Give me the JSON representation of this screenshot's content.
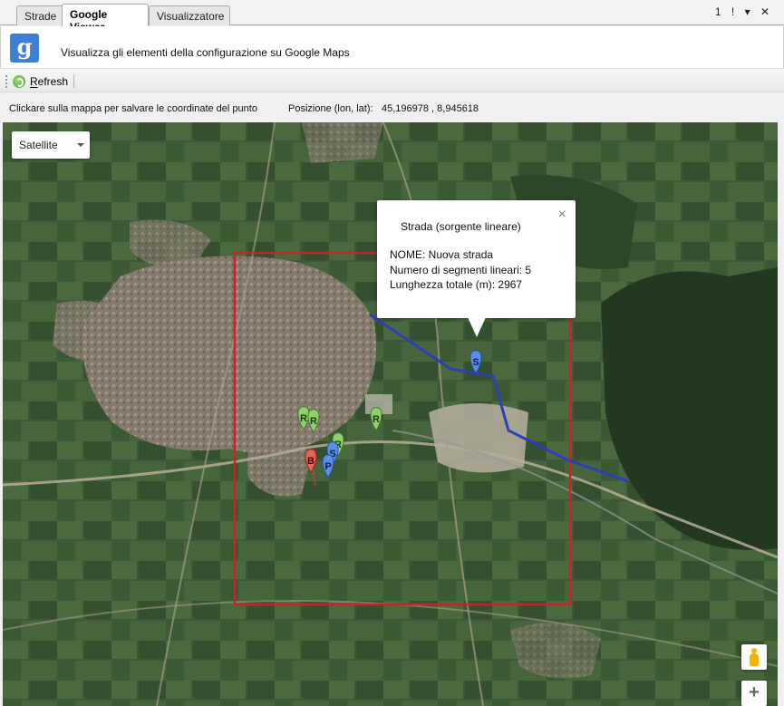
{
  "tabs": [
    {
      "label": "Strade"
    },
    {
      "label": "Google Viewer"
    },
    {
      "label": "Visualizzatore"
    }
  ],
  "tab_controls": "1 ! ▾ ✕",
  "header": {
    "logo_letter": "g",
    "description": "Visualizza gli elementi della configurazione su Google Maps"
  },
  "toolbar": {
    "refresh_first_letter": "R",
    "refresh_rest": "efresh"
  },
  "status": {
    "hint": "Clickare sulla mappa per salvare le coordinate del punto",
    "position_label": "Posizione (lon, lat):",
    "position_value": "45,196978 , 8,945618"
  },
  "map": {
    "type_selected": "Satellite",
    "infowindow": {
      "close": "×",
      "title": "Strada (sorgente lineare)",
      "lines": [
        "NOME: Nuova strada",
        "Numero di segmenti lineari: 5",
        "Lunghezza totale (m): 2967"
      ]
    },
    "markers": [
      {
        "letter": "R",
        "color": "#8fd16f"
      },
      {
        "letter": "R",
        "color": "#8fd16f"
      },
      {
        "letter": "R",
        "color": "#8fd16f"
      },
      {
        "letter": "R",
        "color": "#8fd16f"
      },
      {
        "letter": "B",
        "color": "#e8625a"
      },
      {
        "letter": "S",
        "color": "#5c8ee6"
      },
      {
        "letter": "P",
        "color": "#5c8ee6"
      },
      {
        "letter": "S",
        "color": "#5c8ee6"
      }
    ],
    "zoom_in": "+",
    "colors": {
      "selection_box": "#cc2222",
      "road_line": "#2a3fb8",
      "terrain": "#3c5536",
      "town": "#8a7f72"
    }
  }
}
